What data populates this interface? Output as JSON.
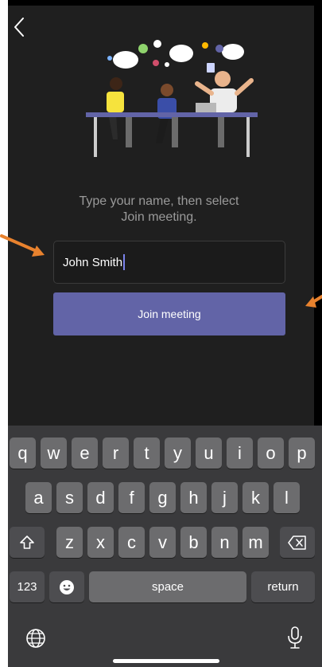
{
  "screen": {
    "prompt_line1": "Type your name, then select",
    "prompt_line2": "Join meeting.",
    "name_value": "John Smith",
    "join_label": "Join meeting"
  },
  "keyboard": {
    "row1": [
      "q",
      "w",
      "e",
      "r",
      "t",
      "y",
      "u",
      "i",
      "o",
      "p"
    ],
    "row2": [
      "a",
      "s",
      "d",
      "f",
      "g",
      "h",
      "j",
      "k",
      "l"
    ],
    "row3": [
      "z",
      "x",
      "c",
      "v",
      "b",
      "n",
      "m"
    ],
    "numbers_label": "123",
    "space_label": "space",
    "return_label": "return"
  },
  "colors": {
    "background": "#1f1f1f",
    "accent": "#6264a7",
    "arrow": "#e8822e"
  },
  "icons": [
    "back-chevron-icon",
    "shift-icon",
    "delete-icon",
    "emoji-icon",
    "globe-icon",
    "microphone-icon"
  ]
}
